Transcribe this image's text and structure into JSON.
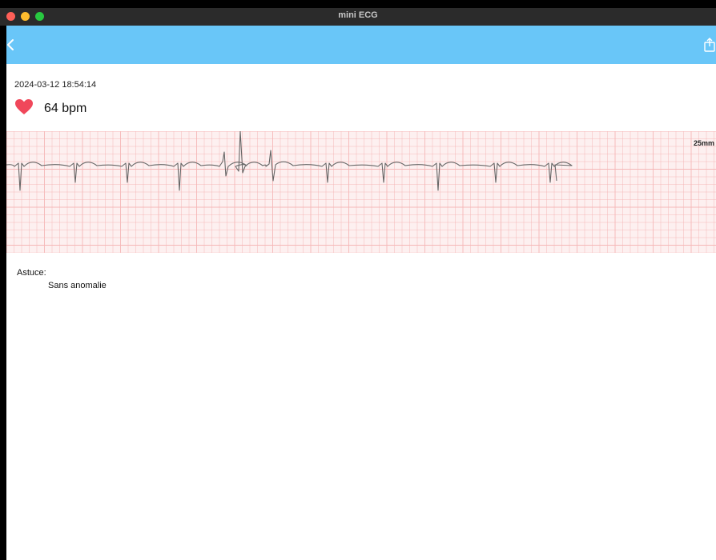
{
  "window": {
    "title": "mini ECG"
  },
  "navbar": {
    "back_icon": "chevron-left-icon",
    "share_icon": "share-icon",
    "color": "#69c6f8"
  },
  "record": {
    "timestamp": "2024-03-12 18:54:14",
    "heart_icon": "heart-icon",
    "heart_color": "#f0475a",
    "bpm": "64 bpm"
  },
  "ecg": {
    "scale": "25mm",
    "grid_color": "#f5b7b7",
    "background": "#fdf0f0",
    "trace_color": "#666666"
  },
  "tip": {
    "label": "Astuce:",
    "value": "Sans anomalie"
  }
}
